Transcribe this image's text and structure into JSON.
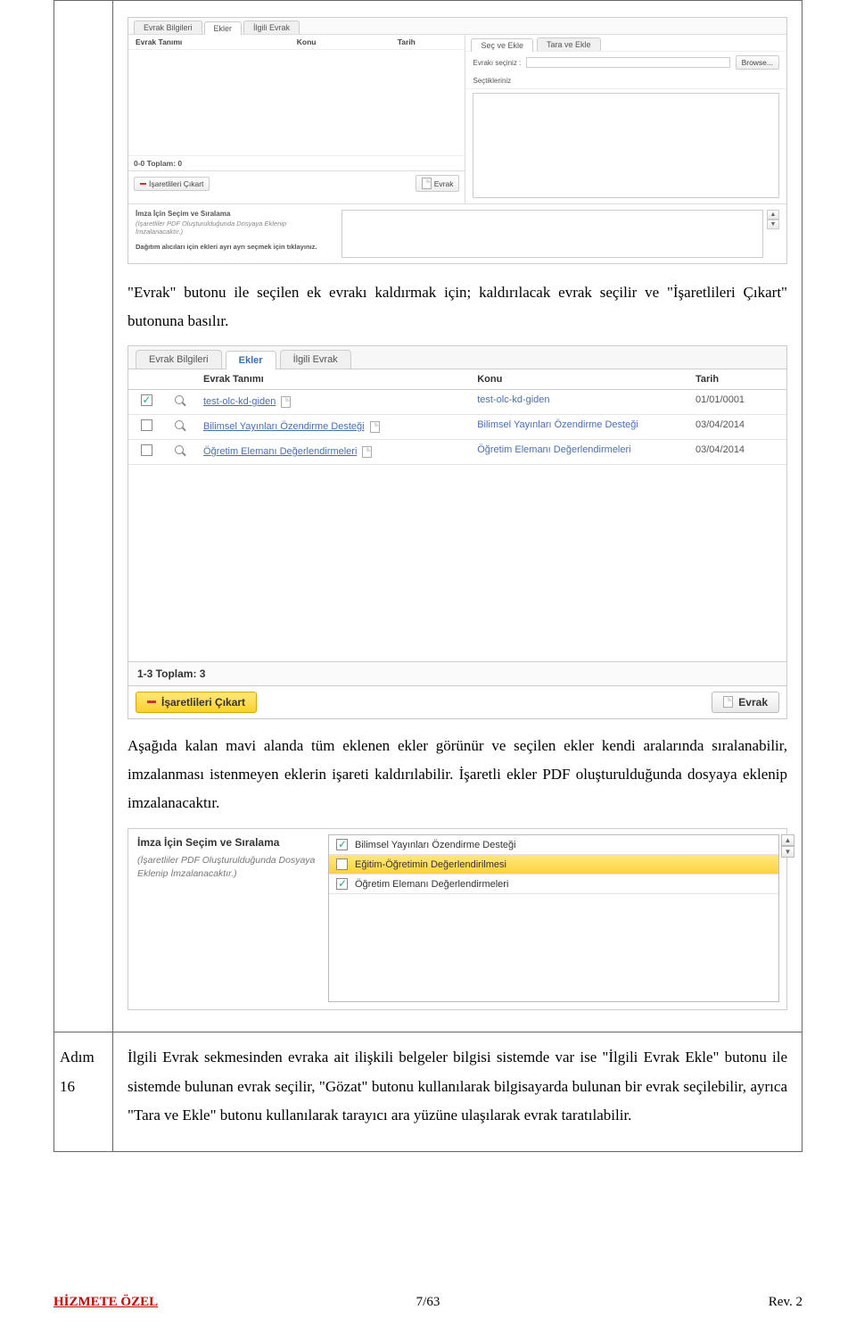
{
  "ss1": {
    "tabs": [
      "Evrak Bilgileri",
      "Ekler",
      "İlgili Evrak"
    ],
    "active_tab": "Ekler",
    "left_cols": [
      "Evrak Tanımı",
      "Konu",
      "Tarih"
    ],
    "total": "0-0 Toplam: 0",
    "btn_left": "İşaretlileri Çıkart",
    "btn_right": "Evrak",
    "right_tabs": [
      "Seç ve Ekle",
      "Tara ve Ekle"
    ],
    "r_label": "Evrakı seçiniz :",
    "r_browse": "Browse...",
    "r_note": "Seçtikleriniz",
    "sig_title": "İmza İçin Seçim ve Sıralama",
    "sig_sub": "(İşaretliler PDF Oluşturulduğunda Dosyaya Eklenip İmzalanacaktır.)",
    "sig_bold": "Dağıtım alıcıları için ekleri ayrı ayrı seçmek için tıklayınız."
  },
  "para1a": "\"Evrak\" butonu ile seçilen ek evrakı kaldırmak için; kaldırılacak evrak seçilir ve \"İşaretlileri Çıkart\" butonuna basılır.",
  "ss2": {
    "tabs": [
      "Evrak Bilgileri",
      "Ekler",
      "İlgili Evrak"
    ],
    "active_tab": "Ekler",
    "thead": {
      "et": "Evrak Tanımı",
      "konu": "Konu",
      "tarih": "Tarih"
    },
    "rows": [
      {
        "checked": true,
        "et": "test-olc-kd-giden",
        "konu": "test-olc-kd-giden",
        "tarih": "01/01/0001"
      },
      {
        "checked": false,
        "et": "Bilimsel Yayınları Özendirme Desteği",
        "konu": "Bilimsel Yayınları Özendirme Desteği",
        "tarih": "03/04/2014"
      },
      {
        "checked": false,
        "et": "Öğretim Elemanı Değerlendirmeleri",
        "konu": "Öğretim Elemanı Değerlendirmeleri",
        "tarih": "03/04/2014"
      }
    ],
    "total": "1-3 Toplam: 3",
    "btn_left": "İşaretlileri Çıkart",
    "btn_right": "Evrak"
  },
  "para2": "Aşağıda kalan mavi alanda tüm eklenen ekler görünür ve seçilen ekler kendi aralarında sıralanabilir, imzalanması istenmeyen eklerin işareti kaldırılabilir. İşaretli ekler PDF oluşturulduğunda dosyaya eklenip imzalanacaktır.",
  "ss3": {
    "title": "İmza İçin Seçim ve Sıralama",
    "sub": "(İşaretliler PDF Oluşturulduğunda Dosyaya Eklenip İmzalanacaktır.)",
    "rows": [
      {
        "checked": true,
        "text": "Bilimsel Yayınları Özendirme Desteği",
        "sel": false
      },
      {
        "checked": false,
        "text": "Eğitim-Öğretimin Değerlendirilmesi",
        "sel": true
      },
      {
        "checked": true,
        "text": "Öğretim Elemanı Değerlendirmeleri",
        "sel": false
      }
    ]
  },
  "step16": {
    "label1": "Adım",
    "label2": "16"
  },
  "para16": "İlgili Evrak sekmesinden evraka ait ilişkili belgeler bilgisi sistemde var ise \"İlgili Evrak Ekle\" butonu ile sistemde bulunan evrak seçilir, \"Gözat\" butonu kullanılarak bilgisayarda bulunan bir evrak seçilebilir, ayrıca \"Tara ve Ekle\" butonu kullanılarak tarayıcı ara yüzüne ulaşılarak evrak taratılabilir.",
  "footer": {
    "left": "HİZMETE ÖZEL",
    "center": "7/63",
    "right": "Rev. 2"
  }
}
